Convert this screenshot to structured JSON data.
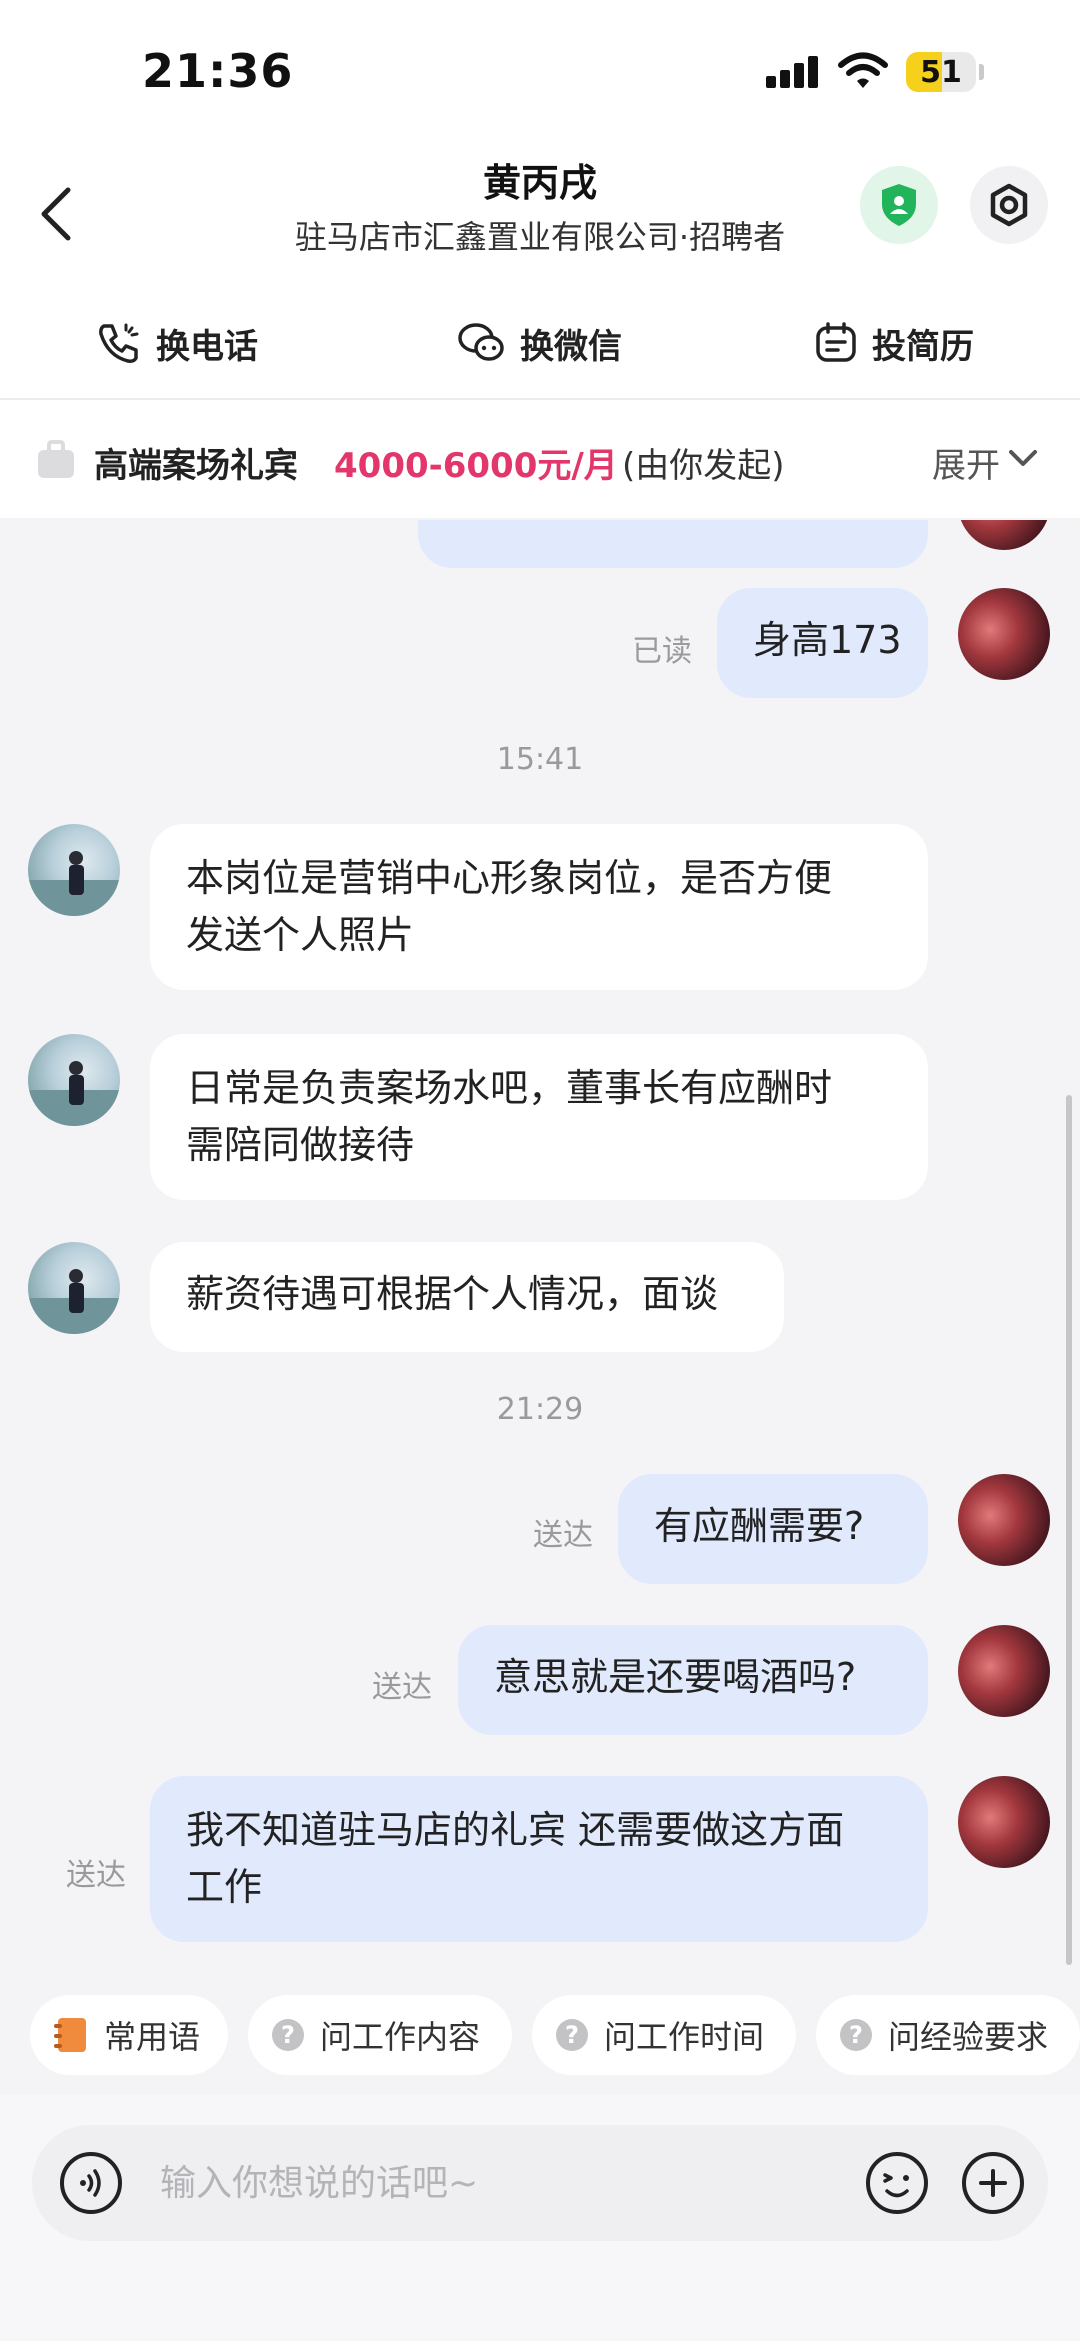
{
  "status_bar": {
    "time": "21:36",
    "battery": "51",
    "battery_level": 0.51
  },
  "header": {
    "name": "黄丙戌",
    "subtitle": "驻马店市汇鑫置业有限公司·招聘者",
    "icons": {
      "back": "chevron-left-icon",
      "shield": "shield-user-icon",
      "settings": "gear-icon"
    }
  },
  "actions": [
    {
      "label": "换电话",
      "icon": "phone-icon"
    },
    {
      "label": "换微信",
      "icon": "wechat-icon"
    },
    {
      "label": "投简历",
      "icon": "resume-icon"
    }
  ],
  "job": {
    "title": "高端案场礼宾",
    "salary": "4000-6000元/月",
    "origin": "(由你发起)",
    "expand": "展开"
  },
  "messages": {
    "m1": {
      "text": "身高173",
      "status": "已读",
      "direction": "out"
    },
    "t1": "15:41",
    "m2": {
      "line1": "本岗位是营销中心形象岗位，是否方便",
      "line2": "发送个人照片",
      "direction": "in"
    },
    "m3": {
      "line1": "日常是负责案场水吧，董事长有应酬时",
      "line2": "需陪同做接待",
      "direction": "in"
    },
    "m4": {
      "text": "薪资待遇可根据个人情况，面谈",
      "direction": "in"
    },
    "t2": "21:29",
    "m5": {
      "text": "有应酬需要?",
      "status": "送达",
      "direction": "out"
    },
    "m6": {
      "text": "意思就是还要喝酒吗?",
      "status": "送达",
      "direction": "out"
    },
    "m7": {
      "line1": "我不知道驻马店的礼宾 还需要做这方面",
      "line2": "工作",
      "status": "送达",
      "direction": "out"
    }
  },
  "quick_replies": [
    "常用语",
    "问工作内容",
    "问工作时间",
    "问经验要求"
  ],
  "composer": {
    "placeholder": "输入你想说的话吧~",
    "icons": [
      "voice-icon",
      "emoji-icon",
      "plus-icon"
    ]
  },
  "colors": {
    "accent_pink": "#e3366a",
    "out_bubble": "#e1e9fd",
    "in_bubble": "#ffffff",
    "shield_green": "#22b45a"
  }
}
